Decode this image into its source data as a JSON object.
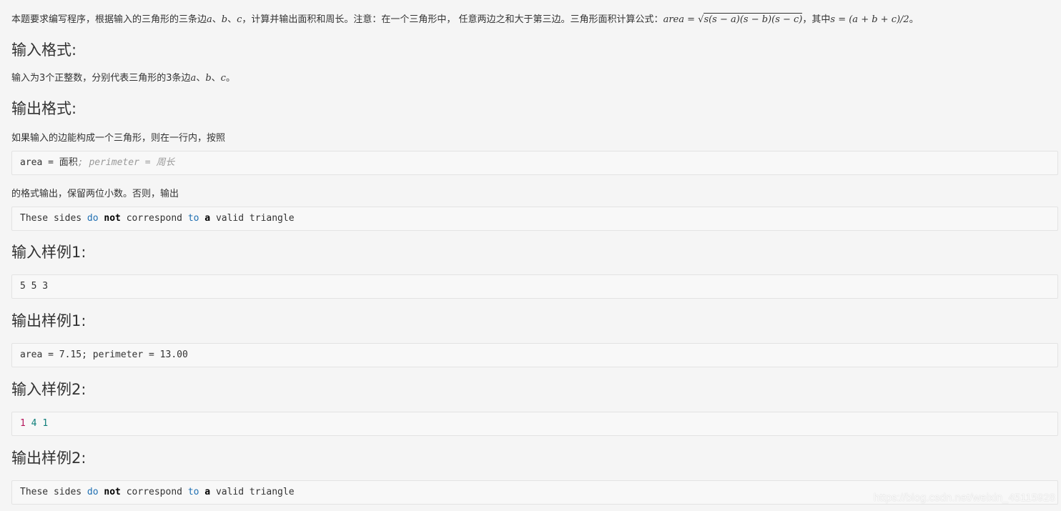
{
  "intro": {
    "part1": "本题要求编写程序，根据输入的三角形的三条边",
    "var_a": "a",
    "sep1": "、",
    "var_b": "b",
    "sep2": "、",
    "var_c": "c",
    "part2": "，计算并输出面积和周长。注意：在一个三角形中， 任意两边之和大于第三边。三角形面积计算公式：",
    "formula_area": "area = ",
    "formula_sqrt": "s(s − a)(s − b)(s − c)",
    "part3": "，其中",
    "formula_s": "s = (a + b + c)/2",
    "part4": "。"
  },
  "sections": {
    "input_format_heading": "输入格式:",
    "input_format_text_pre": "输入为3个正整数，分别代表三角形的3条边",
    "input_format_a": "a",
    "input_format_sep1": "、",
    "input_format_b": "b",
    "input_format_sep2": "、",
    "input_format_c": "c",
    "input_format_end": "。",
    "output_format_heading": "输出格式:",
    "output_format_text1": "如果输入的边能构成一个三角形，则在一行内，按照",
    "output_format_code": {
      "plain": "area = 面积",
      "comment": "; perimeter = 周长"
    },
    "output_format_text2": "的格式输出，保留两位小数。否则，输出",
    "invalid_code": {
      "w1": "These sides ",
      "w2": "do",
      "w3": " ",
      "w4": "not",
      "w5": " correspond ",
      "w6": "to",
      "w7": " ",
      "w8": "a",
      "w9": " valid triangle"
    },
    "sample_input1_heading": "输入样例1:",
    "sample_input1": "5 5 3",
    "sample_output1_heading": "输出样例1:",
    "sample_output1": "area = 7.15; perimeter = 13.00",
    "sample_input2_heading": "输入样例2:",
    "sample_input2": {
      "n1": "1",
      "n2": "4",
      "n3": "1"
    },
    "sample_output2_heading": "输出样例2:",
    "sample_output2": {
      "w1": "These sides ",
      "w2": "do",
      "w3": " ",
      "w4": "not",
      "w5": " correspond ",
      "w6": "to",
      "w7": " ",
      "w8": "a",
      "w9": " valid triangle"
    }
  },
  "watermark": "https://blog.csdn.net/weixin_45115928"
}
